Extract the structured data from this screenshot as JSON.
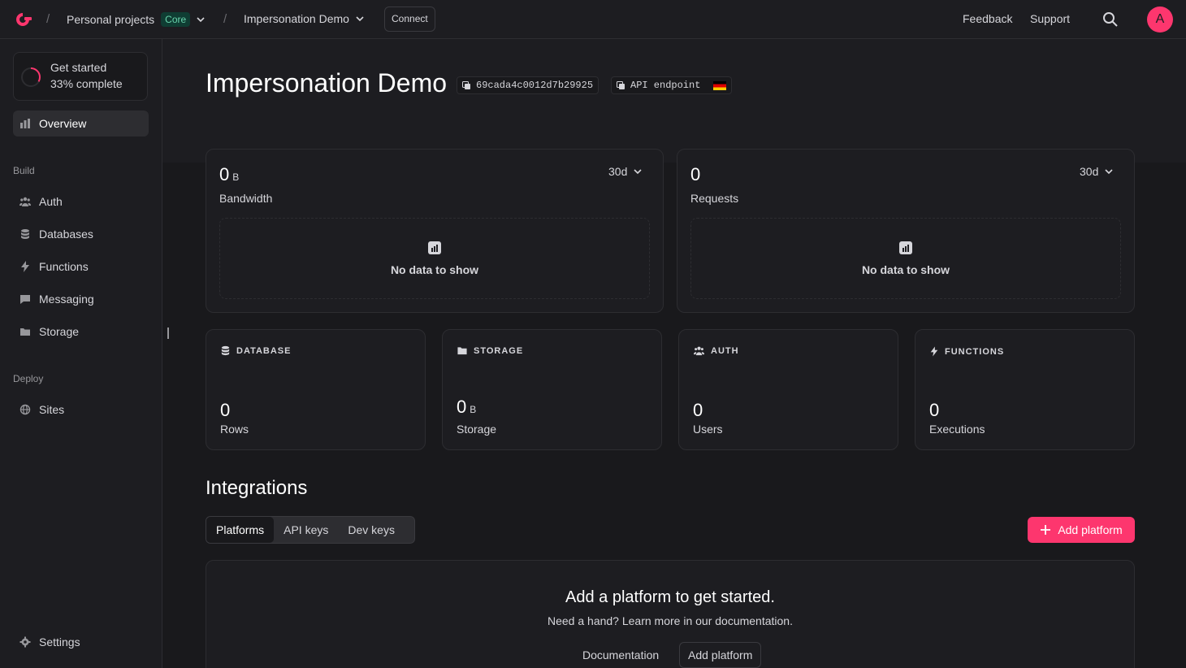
{
  "topbar": {
    "breadcrumb_org": "Personal projects",
    "breadcrumb_org_badge": "Core",
    "breadcrumb_project": "Impersonation Demo",
    "connect_label": "Connect",
    "feedback_label": "Feedback",
    "support_label": "Support",
    "avatar_initial": "A"
  },
  "sidebar": {
    "get_started_title": "Get started",
    "get_started_progress": "33% complete",
    "get_started_fraction": 0.33,
    "overview_label": "Overview",
    "build_label": "Build",
    "build_items": [
      {
        "label": "Auth",
        "icon": "users-icon"
      },
      {
        "label": "Databases",
        "icon": "database-icon"
      },
      {
        "label": "Functions",
        "icon": "lightning-icon"
      },
      {
        "label": "Messaging",
        "icon": "chat-icon"
      },
      {
        "label": "Storage",
        "icon": "folder-icon"
      }
    ],
    "deploy_label": "Deploy",
    "deploy_items": [
      {
        "label": "Sites",
        "icon": "globe-icon"
      }
    ],
    "settings_label": "Settings"
  },
  "header": {
    "title": "Impersonation Demo",
    "project_id": "69cada4c0012d7b29925",
    "api_endpoint_label": "API endpoint"
  },
  "usage": {
    "bandwidth": {
      "value": "0",
      "unit": "B",
      "label": "Bandwidth",
      "period": "30d",
      "empty": "No data to show"
    },
    "requests": {
      "value": "0",
      "label": "Requests",
      "period": "30d",
      "empty": "No data to show"
    }
  },
  "stats": {
    "database": {
      "title": "DATABASE",
      "value": "0",
      "label": "Rows"
    },
    "storage": {
      "title": "STORAGE",
      "value": "0",
      "unit": "B",
      "label": "Storage"
    },
    "auth": {
      "title": "AUTH",
      "value": "0",
      "label": "Users"
    },
    "functions": {
      "title": "FUNCTIONS",
      "value": "0",
      "label": "Executions"
    }
  },
  "integrations": {
    "title": "Integrations",
    "tabs": [
      "Platforms",
      "API keys",
      "Dev keys"
    ],
    "add_platform_label": "Add platform",
    "empty_title": "Add a platform to get started.",
    "empty_sub": "Need a hand? Learn more in our documentation.",
    "documentation_label": "Documentation",
    "add_platform_secondary": "Add platform"
  },
  "colors": {
    "accent": "#fd366e",
    "background": "#19191c",
    "surface": "#1d1d21"
  }
}
